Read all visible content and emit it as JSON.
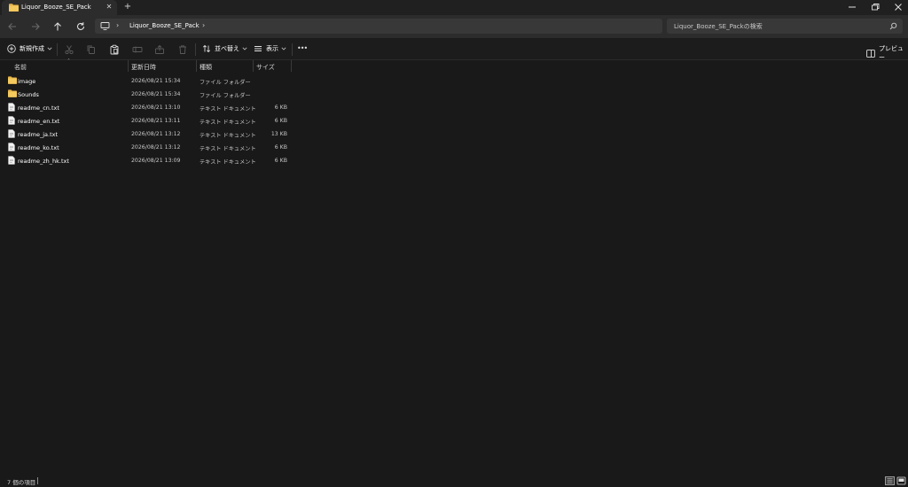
{
  "tab": {
    "title": "Liquor_Booze_SE_Pack",
    "close_label": "✕",
    "new_tab_label": "+"
  },
  "address": {
    "separator": "›",
    "crumb": "Liquor_Booze_SE_Pack"
  },
  "search": {
    "placeholder": "Liquor_Booze_SE_Packの検索"
  },
  "toolbar": {
    "new_label": "新規作成",
    "sort_label": "並べ替え",
    "view_label": "表示",
    "more_label": "•••",
    "preview_label": "プレビュー"
  },
  "columns": {
    "name": "名前",
    "date": "更新日時",
    "type": "種類",
    "size": "サイズ"
  },
  "files": [
    {
      "icon": "folder-icon",
      "name": "image",
      "date": "2026/08/21 15:34",
      "type": "ファイル フォルダー",
      "size": ""
    },
    {
      "icon": "folder-icon",
      "name": "Sounds",
      "date": "2026/08/21 15:34",
      "type": "ファイル フォルダー",
      "size": ""
    },
    {
      "icon": "text-file-icon",
      "name": "readme_cn.txt",
      "date": "2026/08/21 13:10",
      "type": "テキスト ドキュメント",
      "size": "6 KB"
    },
    {
      "icon": "text-file-icon",
      "name": "readme_en.txt",
      "date": "2026/08/21 13:11",
      "type": "テキスト ドキュメント",
      "size": "6 KB"
    },
    {
      "icon": "text-file-icon",
      "name": "readme_ja.txt",
      "date": "2026/08/21 13:12",
      "type": "テキスト ドキュメント",
      "size": "13 KB"
    },
    {
      "icon": "text-file-icon",
      "name": "readme_ko.txt",
      "date": "2026/08/21 13:12",
      "type": "テキスト ドキュメント",
      "size": "6 KB"
    },
    {
      "icon": "text-file-icon",
      "name": "readme_zh_hk.txt",
      "date": "2026/08/21 13:09",
      "type": "テキスト ドキュメント",
      "size": "6 KB"
    }
  ],
  "status": {
    "item_count": "7 個の項目"
  },
  "colors": {
    "background": "#191919",
    "folder": "#e8b64a",
    "accent": "#4cc2ff"
  }
}
